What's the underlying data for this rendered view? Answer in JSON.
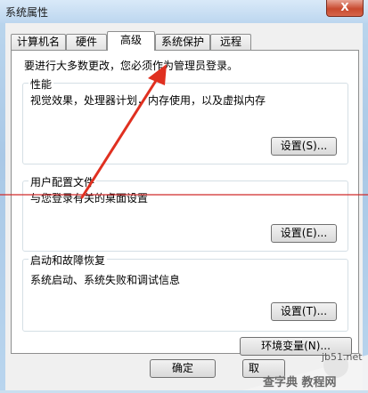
{
  "window": {
    "title": "系统属性",
    "close_glyph": "X"
  },
  "tabs": [
    {
      "label": "计算机名"
    },
    {
      "label": "硬件"
    },
    {
      "label": "高级",
      "active": true
    },
    {
      "label": "系统保护"
    },
    {
      "label": "远程"
    }
  ],
  "notice": "要进行大多数更改，您必须作为管理员登录。",
  "performance": {
    "title": "性能",
    "desc": "视觉效果，处理器计划，内存使用，以及虚拟内存",
    "button": "设置(S)..."
  },
  "user_profiles": {
    "title": "用户配置文件",
    "desc": "与您登录有关的桌面设置",
    "button": "设置(E)..."
  },
  "startup": {
    "title": "启动和故障恢复",
    "desc": "系统启动、系统失败和调试信息",
    "button": "设置(T)..."
  },
  "env_button": "环境变量(N)...",
  "footer": {
    "ok": "确定",
    "cancel_partial": "取"
  },
  "watermark": {
    "line1": "jb51.net",
    "line2": "查字典 教程网"
  },
  "colors": {
    "arrow": "#e03020",
    "guide_line": "#d02a2a",
    "accent": "#3c7fb1"
  }
}
